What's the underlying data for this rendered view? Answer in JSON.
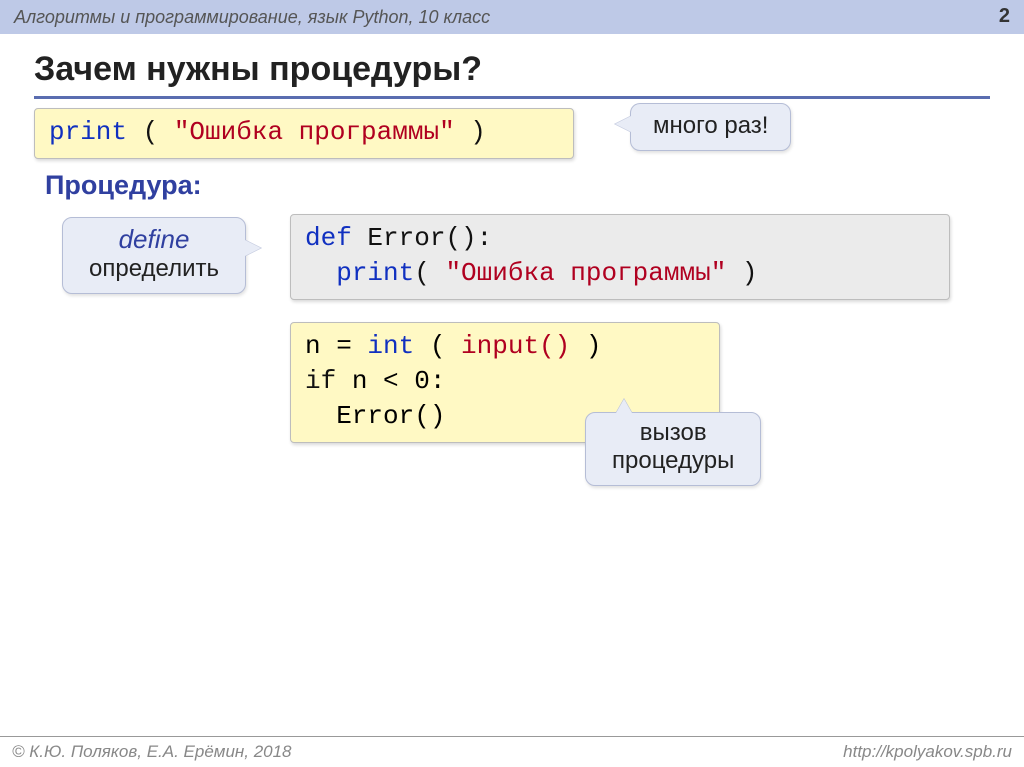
{
  "header": {
    "course": "Алгоритмы и программирование, язык Python, 10 класс",
    "page": "2"
  },
  "title": "Зачем нужны процедуры?",
  "code1": {
    "print_kw": "print",
    "open": " ( ",
    "str": "\"Ошибка программы\"",
    "close": " )"
  },
  "callout_many": "много раз!",
  "subtitle": "Процедура:",
  "callout_define": {
    "word": "define",
    "meaning": "определить"
  },
  "code2": {
    "def_kw": "def",
    "fname": " Error():",
    "indent": "  ",
    "print_kw": "print",
    "open": "( ",
    "str": "\"Ошибка программы\"",
    "close": " )"
  },
  "code3": {
    "line1_a": "n = ",
    "int_kw": "int",
    "line1_b": " ( ",
    "input_kw": "input()",
    "line1_c": " )",
    "line2_a": "if",
    "line2_b": " n < 0:",
    "line3": "  Error()"
  },
  "callout_call": {
    "l1": "вызов",
    "l2": "процедуры"
  },
  "footer": {
    "left": "© К.Ю. Поляков, Е.А. Ерёмин, 2018",
    "right": "http://kpolyakov.spb.ru"
  }
}
